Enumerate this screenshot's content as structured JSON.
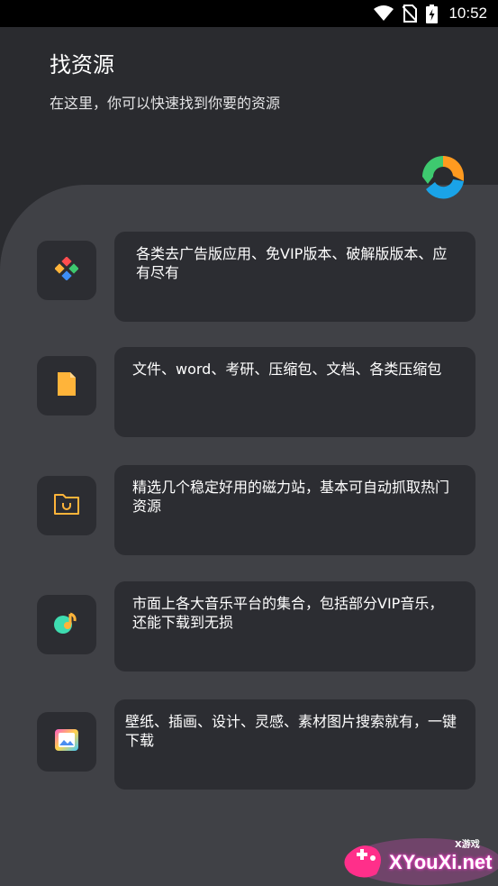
{
  "status_bar": {
    "time": "10:52",
    "icons": [
      "wifi-icon",
      "no-sim-icon",
      "battery-charging-icon"
    ]
  },
  "header": {
    "title": "找资源",
    "subtitle": "在这里，你可以快速找到你要的资源"
  },
  "items": [
    {
      "icon": "app-grid-icon",
      "text": "各类去广告版应用、免VIP版本、破解版版本、应有尽有"
    },
    {
      "icon": "file-icon",
      "text": "文件、word、考研、压缩包、文档、各类压缩包"
    },
    {
      "icon": "magnet-folder-icon",
      "text": "精选几个稳定好用的磁力站，基本可自动抓取热门资源"
    },
    {
      "icon": "music-icon",
      "text": "市面上各大音乐平台的集合，包括部分VIP音乐，还能下载到无损"
    },
    {
      "icon": "picture-icon",
      "text": "壁纸、插画、设计、灵感、素材图片搜索就有，一键下载"
    }
  ],
  "watermark": {
    "text": "XYouXi.net",
    "small": "X游戏"
  },
  "colors": {
    "background_top": "#2a2b2f",
    "panel": "#404146",
    "card": "#2c2d32",
    "accent_yellow": "#ffb43a",
    "accent_green": "#3ec96f",
    "accent_blue": "#1aa3e8",
    "accent_orange": "#ff9a1f"
  }
}
